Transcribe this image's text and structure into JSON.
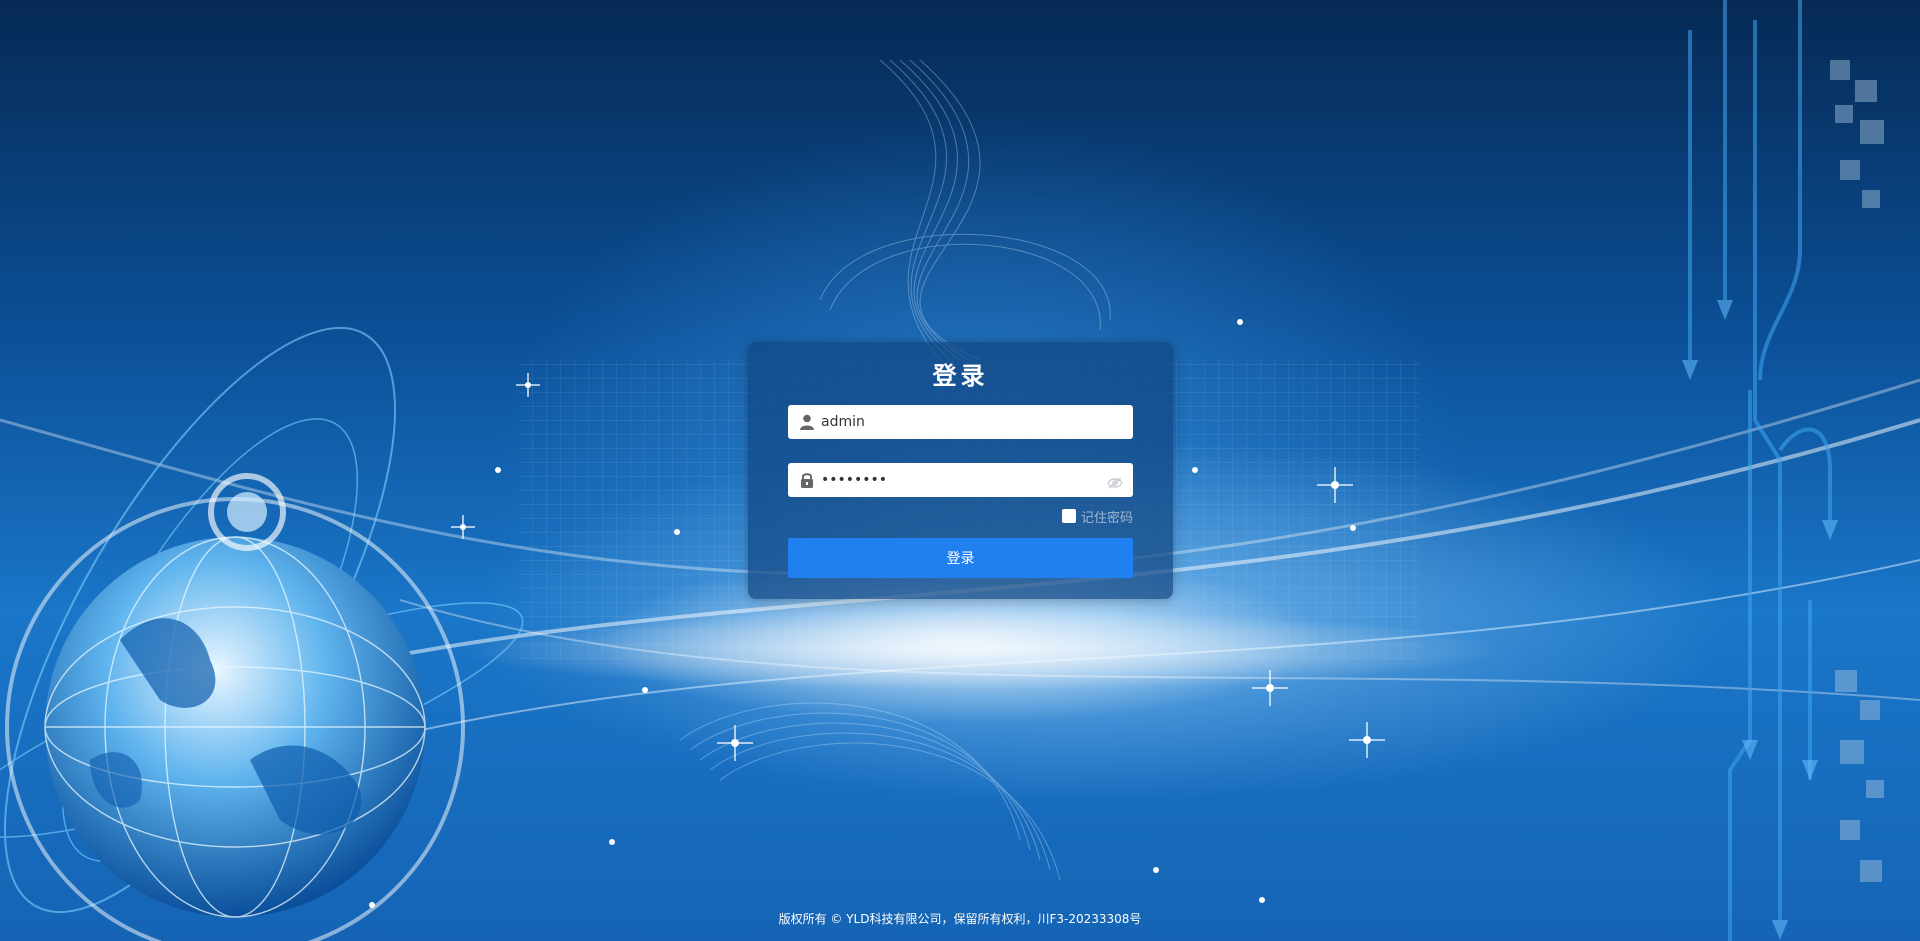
{
  "login": {
    "title": "登录",
    "username_value": "admin",
    "password_value": "12345678",
    "remember_label": "记住密码",
    "submit_label": "登录"
  },
  "footer": {
    "copyright": "版权所有 © YLD科技有限公司，保留所有权利，川F3-20233308号"
  },
  "icons": {
    "username": "user-icon",
    "password": "lock-icon",
    "toggle": "eye-icon"
  },
  "colors": {
    "accent": "#2080f0",
    "card": "#12468299",
    "background": "#0b4f96"
  }
}
